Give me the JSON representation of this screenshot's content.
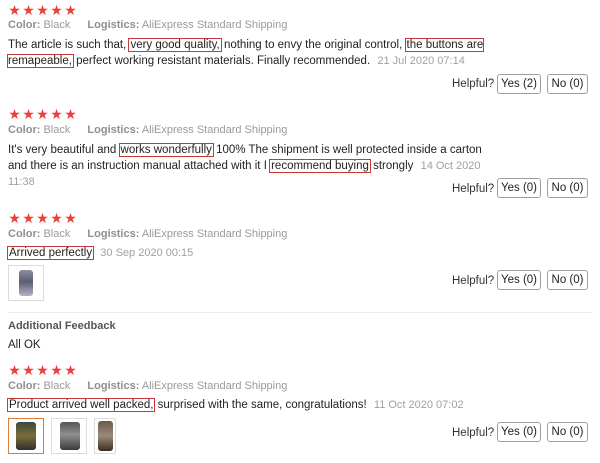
{
  "labels": {
    "color": "Color:",
    "logistics": "Logistics:",
    "helpful": "Helpful?"
  },
  "colors": {
    "star": "#e8423a",
    "highlight_box": "#c6393b",
    "meta_text": "#9a9a9a"
  },
  "reviews": [
    {
      "rating": 5,
      "color_value": "Black",
      "logistics_value": "AliExpress Standard Shipping",
      "text_parts": [
        "The article is such that, ",
        "very good quality,",
        " nothing to envy the original control, ",
        "the buttons are remapeable,",
        " perfect working resistant materials. Finally recommended."
      ],
      "date": "21 Jul 2020 07:14",
      "yes_label": "Yes (2)",
      "no_label": "No (0)"
    },
    {
      "rating": 5,
      "color_value": "Black",
      "logistics_value": "AliExpress Standard Shipping",
      "text_parts": [
        "It's very beautiful and ",
        "works wonderfully",
        " 100% The shipment is well protected inside a carton and there is an instruction manual attached with it I ",
        "recommend buying",
        " strongly"
      ],
      "date": "14 Oct 2020 11:38",
      "yes_label": "Yes (0)",
      "no_label": "No (0)"
    },
    {
      "rating": 5,
      "color_value": "Black",
      "logistics_value": "AliExpress Standard Shipping",
      "text_parts": [
        "Arrived perfectly"
      ],
      "date": "30 Sep 2020 00:15",
      "yes_label": "Yes (0)",
      "no_label": "No (0)",
      "additional_feedback_title": "Additional Feedback",
      "additional_feedback_text": "All OK"
    },
    {
      "rating": 5,
      "color_value": "Black",
      "logistics_value": "AliExpress Standard Shipping",
      "text_parts": [
        "Product arrived well packed,",
        " surprised with the same, congratulations!"
      ],
      "date": "11 Oct 2020 07:02",
      "yes_label": "Yes (0)",
      "no_label": "No (0)"
    }
  ]
}
